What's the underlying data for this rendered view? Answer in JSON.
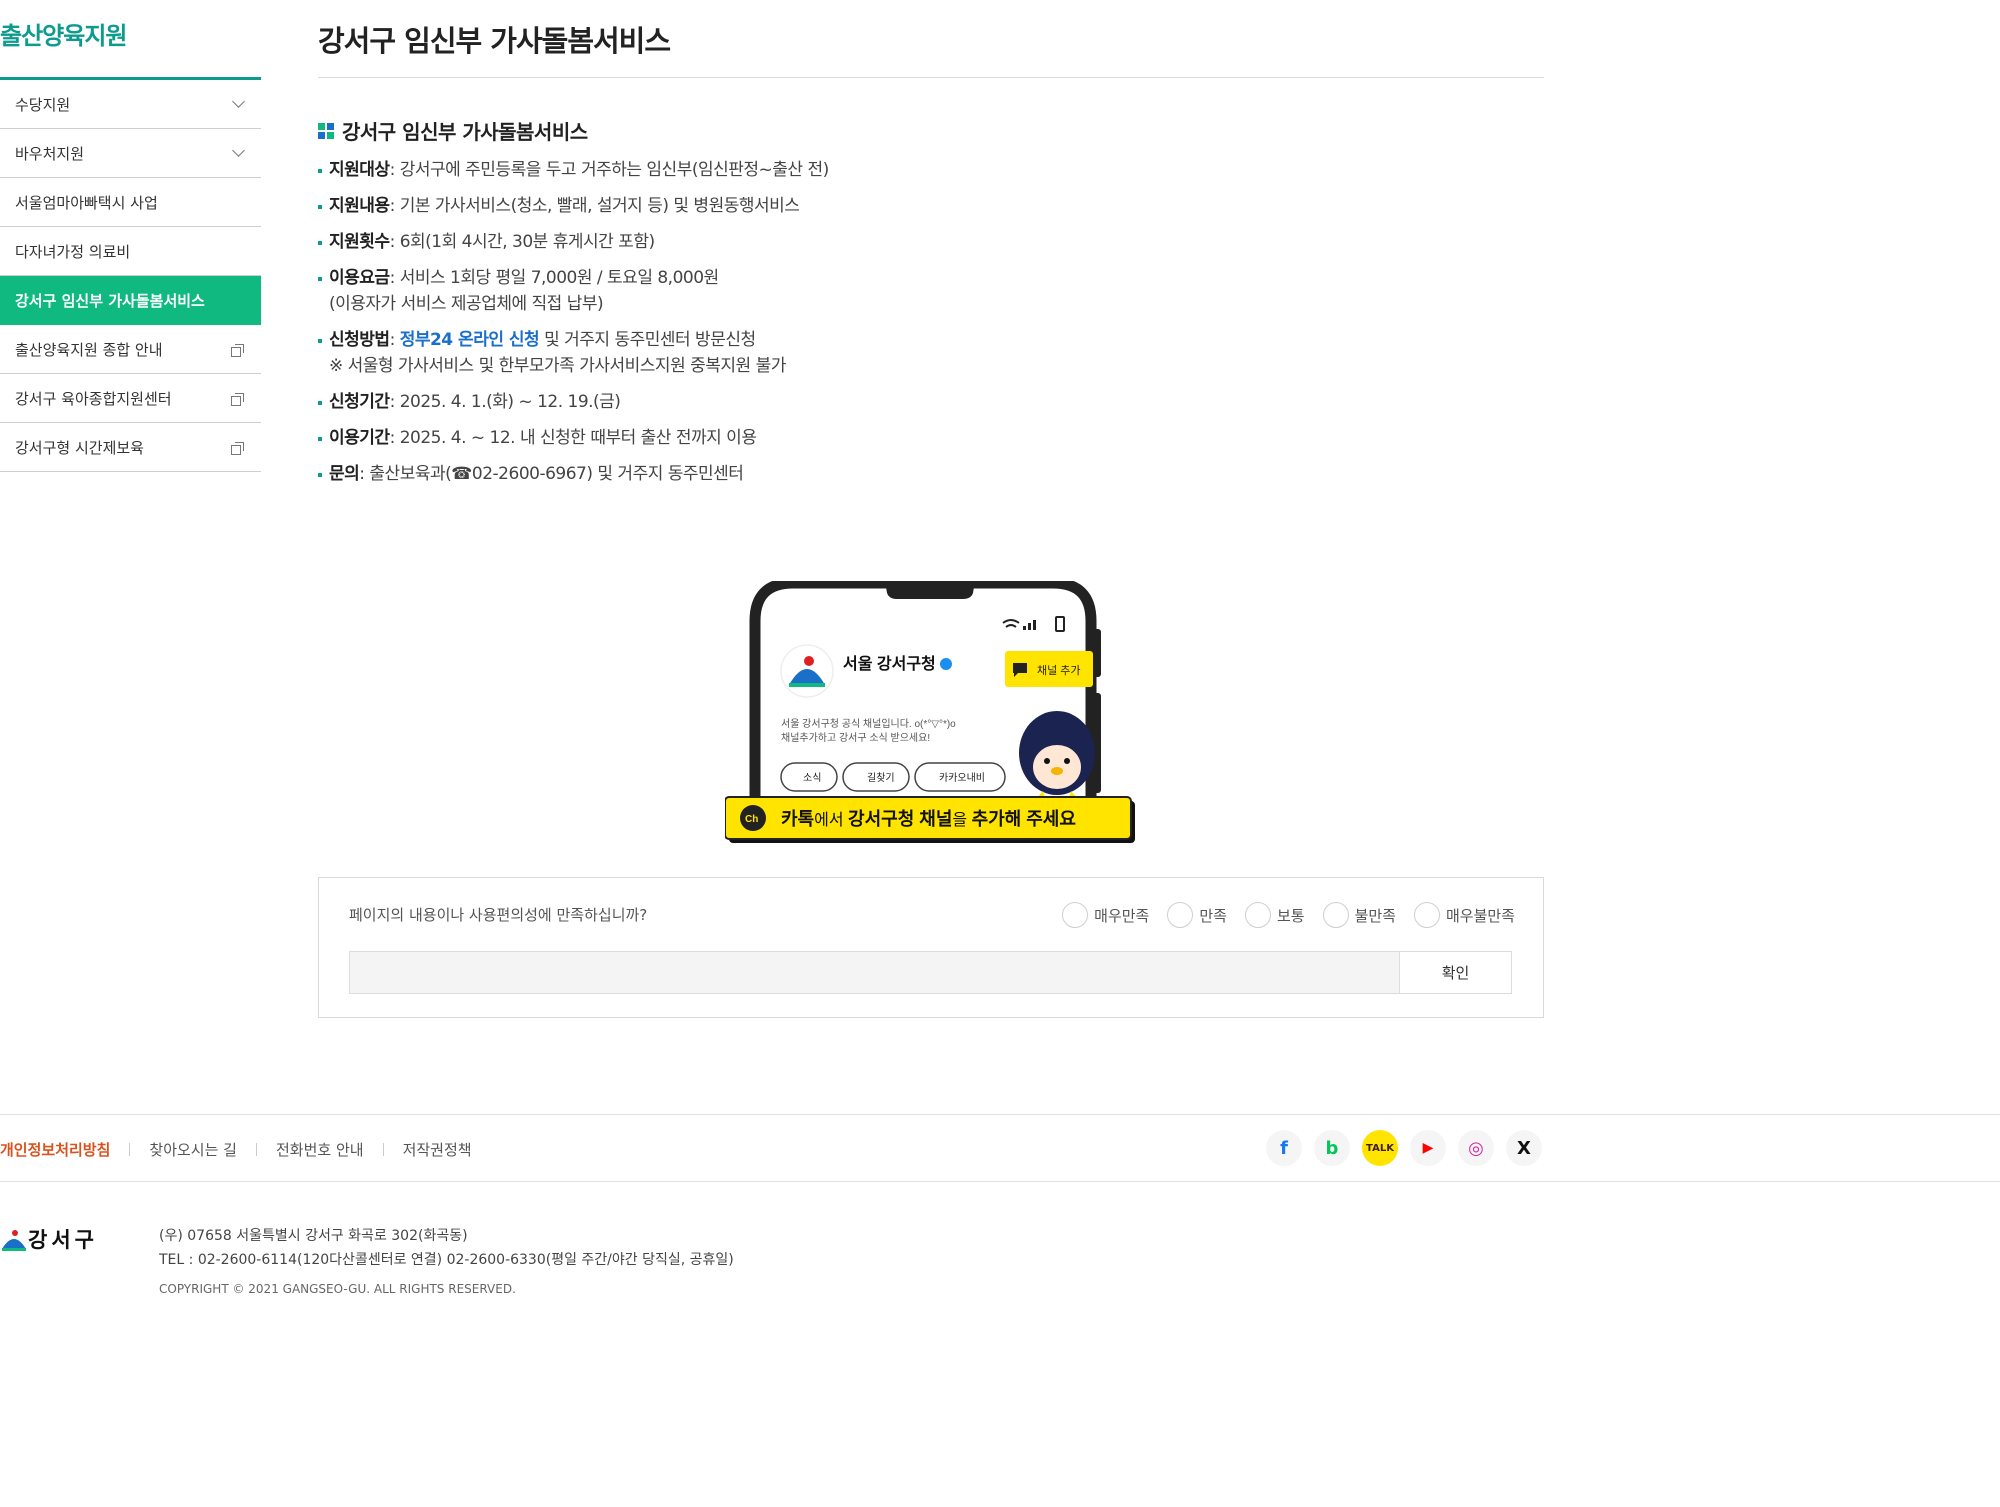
{
  "sidebar": {
    "title": "출산양육지원",
    "items": [
      {
        "label": "수당지원"
      },
      {
        "label": "바우처지원"
      },
      {
        "label": "서울엄마아빠택시 사업"
      },
      {
        "label": "다자녀가정 의료비"
      },
      {
        "label": "강서구 임신부 가사돌봄서비스"
      },
      {
        "label": "출산양육지원 종합 안내"
      },
      {
        "label": "강서구 육아종합지원센터"
      },
      {
        "label": "강서구형 시간제보육"
      }
    ]
  },
  "main": {
    "title": "강서구 임신부 가사돌봄서비스",
    "section_title": "강서구 임신부 가사돌봄서비스",
    "info": [
      {
        "label": "지원대상",
        "text": ": 강서구에 주민등록을 두고 거주하는 임신부(임신판정~출산 전)"
      },
      {
        "label": "지원내용",
        "text": ": 기본 가사서비스(청소, 빨래, 설거지 등) 및 병원동행서비스"
      },
      {
        "label": "지원횟수",
        "text": ": 6회(1회 4시간, 30분 휴게시간 포함)"
      },
      {
        "label": "이용요금",
        "text": ": 서비스 1회당 평일 7,000원 / 토요일 8,000원",
        "line2": "(이용자가 서비스 제공업체에 직접 납부)"
      },
      {
        "label": "신청방법",
        "text_pre": ": ",
        "link": "정부24 온라인 신청",
        "text": " 및 거주지 동주민센터 방문신청",
        "line2": "※ 서울형 가사서비스 및 한부모가족 가사서비스지원 중복지원 불가"
      },
      {
        "label": "신청기간",
        "text": ": 2025. 4. 1.(화) ~ 12. 19.(금)"
      },
      {
        "label": "이용기간",
        "text": ": 2025. 4. ~ 12. 내 신청한 때부터 출산 전까지 이용"
      },
      {
        "label": "문의",
        "text": ": 출산보육과(☎02-2600-6967) 및 거주지 동주민센터"
      }
    ]
  },
  "banner": {
    "channel_name": "서울 강서구청",
    "add_button": "채널 추가",
    "desc_line1": "서울 강서구청 공식 채널입니다. o(*°▽°*)o",
    "desc_line2": "채널추가하고 강서구 소식 받으세요!",
    "chips": [
      "소식",
      "길찾기",
      "카카오내비"
    ],
    "cta_pre": "카톡",
    "cta_mid1": "에서 ",
    "cta_bold": "강서구청 채널",
    "cta_mid2": "을 ",
    "cta_bold2": "추가해",
    "cta_post": " 주세요",
    "ch_label": "Ch",
    "accent_yellow": "#ffe400"
  },
  "survey": {
    "question": "페이지의 내용이나 사용편의성에 만족하십니까?",
    "options": [
      "매우만족",
      "만족",
      "보통",
      "불만족",
      "매우불만족"
    ],
    "confirm": "확인"
  },
  "footer": {
    "links": [
      "개인정보처리방침",
      "찾아오시는 길",
      "전화번호 안내",
      "저작권정책"
    ],
    "social": [
      {
        "icon": "facebook-icon",
        "glyph": "f",
        "color": "#1877f2",
        "bg": "#f5f5f5"
      },
      {
        "icon": "blog-icon",
        "glyph": "b",
        "color": "#03c75a",
        "bg": "#f5f5f5"
      },
      {
        "icon": "kakaotalk-icon",
        "glyph": "TALK",
        "color": "#3c1e1e",
        "bg": "#ffe400"
      },
      {
        "icon": "youtube-icon",
        "glyph": "▶",
        "color": "#ff0000",
        "bg": "#f5f5f5"
      },
      {
        "icon": "instagram-icon",
        "glyph": "◎",
        "color": "#d6249f",
        "bg": "#f5f5f5"
      },
      {
        "icon": "x-icon",
        "glyph": "X",
        "color": "#111111",
        "bg": "#f5f5f5"
      }
    ],
    "logo_text": "강서구",
    "address": "(우) 07658 서울특별시 강서구 화곡로 302(화곡동)",
    "tel": "TEL : 02-2600-6114(120다산콜센터로 연결) 02-2600-6330(평일 주간/야간 당직실, 공휴일)",
    "copyright": "COPYRIGHT © 2021 GANGSEO-GU. ALL RIGHTS RESERVED."
  }
}
